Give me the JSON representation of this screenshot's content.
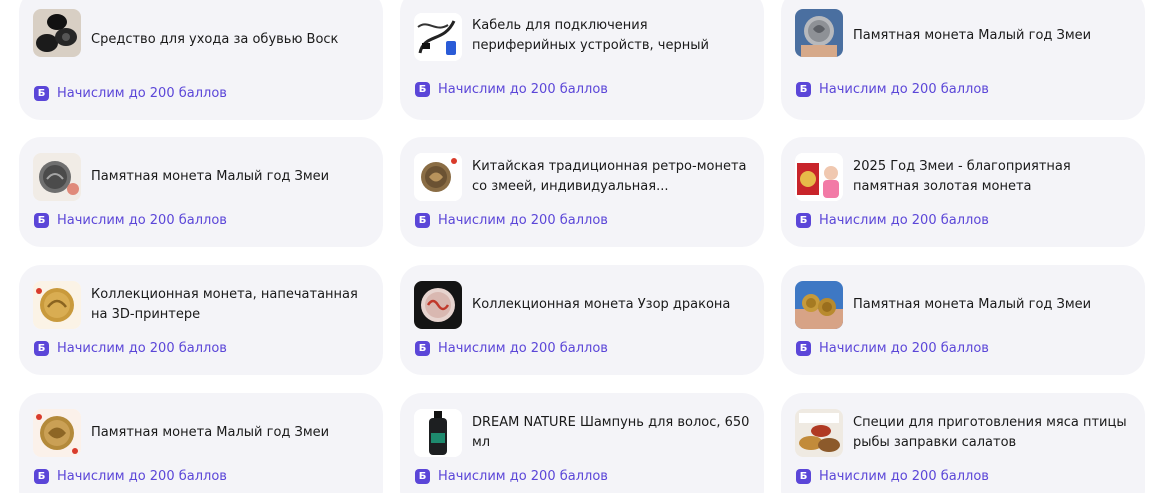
{
  "bonus_text": "Начислим до 200 баллов",
  "bonus_badge": "Б",
  "accent_color": "#5b46d8",
  "card_background": "#f4f4f8",
  "products": [
    {
      "title": "Средство для ухода за обувью Воск",
      "icon": "shoe-wax-image"
    },
    {
      "title": "Кабель для подключения периферийных устройств, черный",
      "icon": "cable-image"
    },
    {
      "title": "Памятная монета Малый год Змеи",
      "icon": "coin-in-hand-image"
    },
    {
      "title": "Памятная монета Малый год Змеи",
      "icon": "coin-silver-image"
    },
    {
      "title": "Китайская традиционная ретро-монета со змеей, индивидуальная...",
      "icon": "coin-retro-image"
    },
    {
      "title": "2025 Год Змеи - благоприятная памятная золотая монета",
      "icon": "gold-coin-promo-image"
    },
    {
      "title": "Коллекционная монета, напечатанная на 3D-принтере",
      "icon": "coin-3d-image"
    },
    {
      "title": "Коллекционная монета Узор дракона",
      "icon": "dragon-coin-image"
    },
    {
      "title": "Памятная монета Малый год Змеи",
      "icon": "coins-in-hand-image"
    },
    {
      "title": "Памятная монета Малый год Змеи",
      "icon": "coin-gold-image"
    },
    {
      "title": "DREAM NATURE Шампунь для волос, 650 мл",
      "icon": "shampoo-bottle-image"
    },
    {
      "title": "Специи для приготовления мяса птицы рыбы заправки салатов",
      "icon": "spices-image"
    }
  ]
}
